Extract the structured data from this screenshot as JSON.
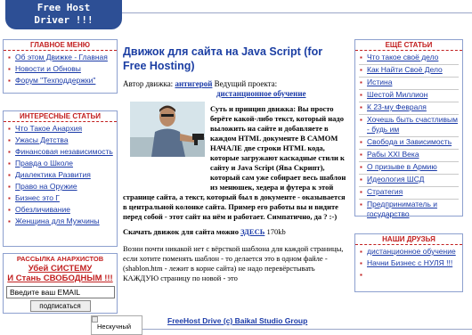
{
  "logo": {
    "line1": "Free Host",
    "line2": "Driver !!!"
  },
  "left_menu": {
    "title": "Главное меню",
    "items": [
      {
        "label": "Об этом Движке - Главная"
      },
      {
        "label": "Новости и Обновы"
      },
      {
        "label": "Форум \"Техподдержки\""
      }
    ]
  },
  "interesting": {
    "title": "Интересные статьи",
    "items": [
      {
        "label": "Что Такое Анархия"
      },
      {
        "label": "Ужасы Детства"
      },
      {
        "label": "Финансовая независимость"
      },
      {
        "label": "Правда о Школе"
      },
      {
        "label": "Диалектика Развития"
      },
      {
        "label": "Право на Оружие"
      },
      {
        "label": "Бизнес это Г"
      },
      {
        "label": "Обезличивание"
      },
      {
        "label": "Женщина для Мужчины"
      }
    ]
  },
  "mailing": {
    "title": "Рассылка анархистов",
    "slogan1": "Убей СИСТЕМУ",
    "slogan2": "И Стань СВОБОДНЫМ !!!",
    "email_value": "Введите ваш EMAIL",
    "subscribe": "подписаться"
  },
  "main": {
    "title": "Движок для сайта на Java Script (for Free Hosting)",
    "author_label": "Автор движка:",
    "author_link": "антигерой",
    "project_label": "Ведущий проекта:",
    "project_link": "дистанционное обучение",
    "bold_text": "Суть и принцип движка: Вы просто берёте какой-либо текст, который надо выложить на сайте и добавляете в каждом HTML документе В САМОМ НАЧАЛЕ две строки HTML кода, которые загружают каскадные стили к сайту и Java Script (Ява Скрипт), который сам уже собирает весь шаблон из менюшек, хедера и футера к этой странице сайта, а текст, который был в документе - оказывается в центральной колонке сайта. Пример его работы вы и видите перед собой - этот сайт на нём и работает. Симпатично, да ? :-)",
    "download_label": "Скачать движок для сайта можно",
    "download_link": "ЗДЕСЬ",
    "download_size": "170kb",
    "normal_text": "Возни почти никакой нет с вёрсткой шаблона для каждой страницы, если хотите поменять шаблон - то делается это в одном файле - (shablon.htm - лежит в корне сайта) не надо перевёрстывать КАЖДУЮ страницу по новой - это"
  },
  "right_articles": {
    "title": "Ещё статьи",
    "items": [
      {
        "label": "Что такое своё дело"
      },
      {
        "label": "Как Найти Своё Дело"
      },
      {
        "label": "Истина"
      },
      {
        "label": "Шестой Миллион"
      },
      {
        "label": "К 23-му Февраля"
      },
      {
        "label": "Хочешь быть счастливым - будь им"
      },
      {
        "label": "Свобода и Зависимость"
      },
      {
        "label": "Рабы XXI Века"
      },
      {
        "label": "О призыве в Армию"
      },
      {
        "label": "Идеология ШСД"
      },
      {
        "label": "Стратегия"
      },
      {
        "label": "Предприниматель и государство"
      }
    ]
  },
  "friends": {
    "title": "Наши друзья",
    "items": [
      {
        "label": "дистанционное обучение"
      },
      {
        "label": "Начни Бизнес с НУЛЯ !!!"
      },
      {
        "label": ""
      },
      {
        "label": ""
      }
    ]
  },
  "footer": {
    "image_alt": "Нескучный",
    "text": "FreeHost Drive (c) Baikal Studio Group"
  }
}
